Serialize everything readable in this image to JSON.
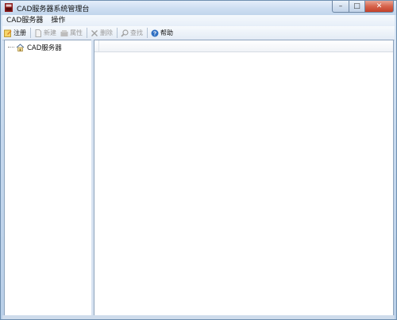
{
  "window": {
    "title": "CAD服务器系统管理台",
    "caption": {
      "minimize": "–",
      "maximize": "□",
      "close": "✕"
    }
  },
  "menubar": {
    "items": [
      {
        "label": "CAD服务器"
      },
      {
        "label": "操作"
      }
    ]
  },
  "toolbar": {
    "buttons": [
      {
        "label": "注册",
        "icon": "register-icon",
        "enabled": true
      },
      {
        "label": "新建",
        "icon": "new-document-icon",
        "enabled": false
      },
      {
        "label": "属性",
        "icon": "properties-icon",
        "enabled": false
      },
      {
        "label": "删除",
        "icon": "delete-icon",
        "enabled": false
      },
      {
        "label": "查找",
        "icon": "search-icon",
        "enabled": false
      },
      {
        "label": "帮助",
        "icon": "help-icon",
        "enabled": true
      }
    ]
  },
  "tree": {
    "root": {
      "label": "CAD服务器",
      "icon": "server-home-icon"
    }
  },
  "colors": {
    "titlebar": "#c1d5ec",
    "close_button": "#c2412a",
    "pane_border": "#8ea4bd",
    "disabled_text": "#9a9a9a"
  }
}
